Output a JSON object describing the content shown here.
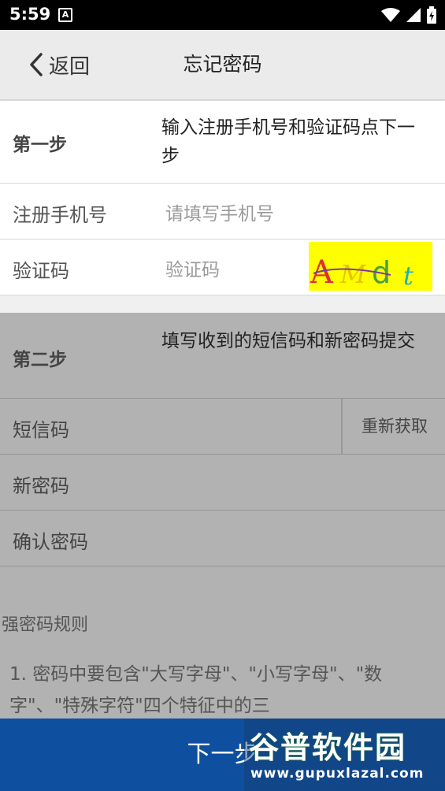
{
  "status_bar": {
    "time": "5:59",
    "notification_glyph": "A",
    "icons": [
      "wifi-icon",
      "signal-icon",
      "battery-icon"
    ]
  },
  "nav": {
    "back_label": "返回",
    "title": "忘记密码"
  },
  "step1": {
    "label": "第一步",
    "description": "输入注册手机号和验证码点下一步"
  },
  "phone_row": {
    "label": "注册手机号",
    "placeholder": "请填写手机号"
  },
  "captcha_row": {
    "label": "验证码",
    "placeholder": "验证码",
    "captcha_text": "AMdt"
  },
  "step2": {
    "label": "第二步",
    "description": "填写收到的短信码和新密码提交"
  },
  "sms_row": {
    "label": "短信码",
    "resend_label": "重新获取"
  },
  "new_pwd_row": {
    "label": "新密码"
  },
  "confirm_pwd_row": {
    "label": "确认密码"
  },
  "rules": {
    "title": "强密码规则",
    "items": [
      "1. 密码中要包含\"大写字母\"、\"小写字母\"、\"数字\"、\"特殊字符\"四个特征中的三"
    ]
  },
  "next_button": {
    "label": "下一步"
  },
  "watermark": {
    "title": "谷普软件园",
    "url": "www.gupuxlazal.com"
  },
  "colors": {
    "primary": "#0f4f9f",
    "captcha_bg": "#ffff00",
    "disabled_overlay": "#b2b2b2"
  }
}
